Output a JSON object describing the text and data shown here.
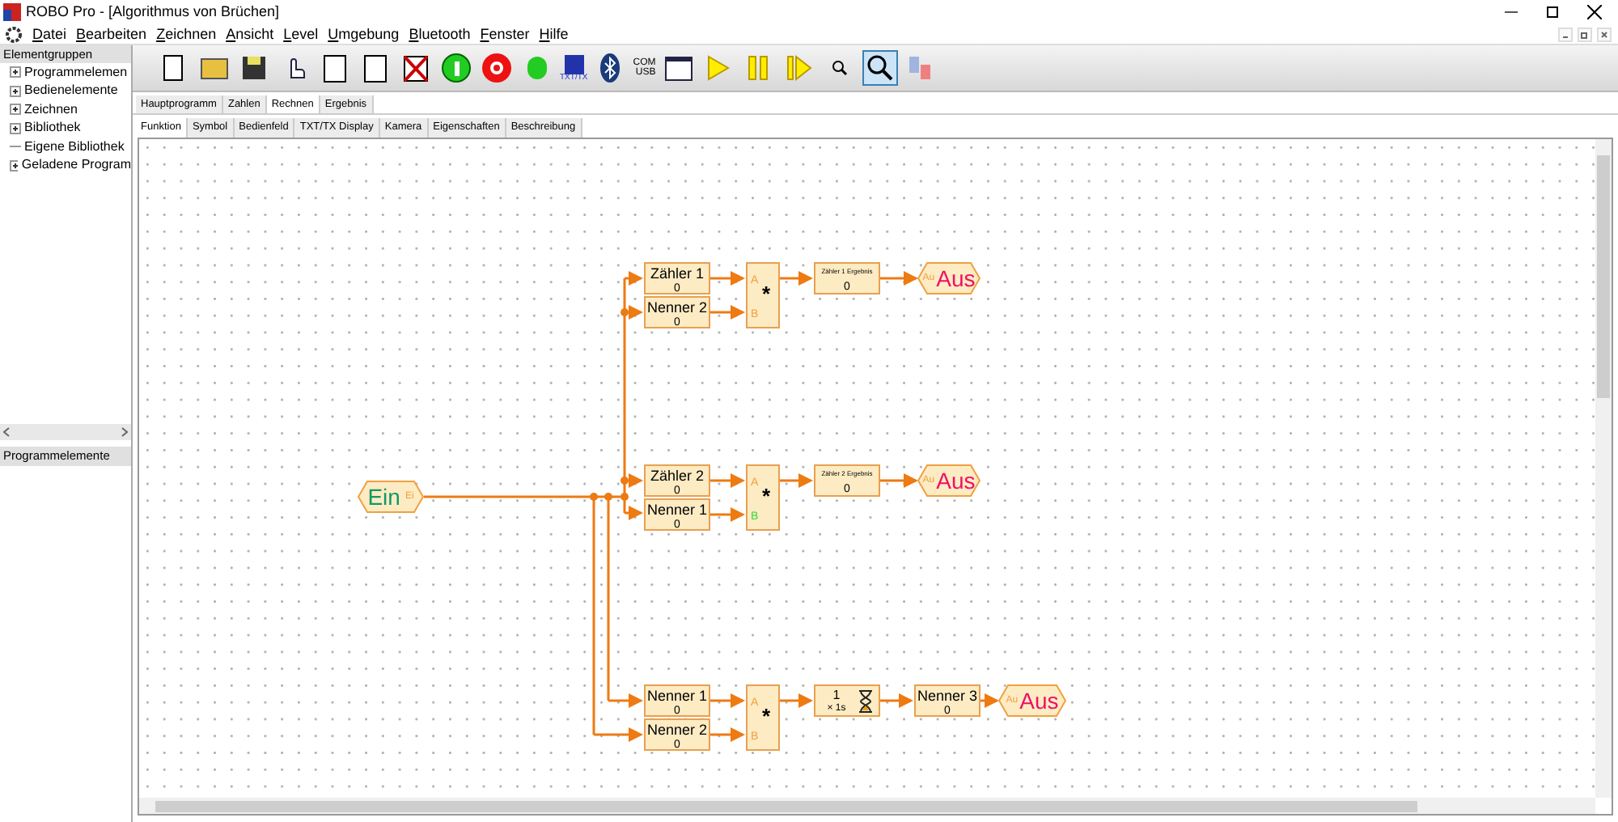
{
  "window": {
    "title": "ROBO Pro - [Algorithmus von Brüchen]"
  },
  "menu": [
    "Datei",
    "Bearbeiten",
    "Zeichnen",
    "Ansicht",
    "Level",
    "Umgebung",
    "Bluetooth",
    "Fenster",
    "Hilfe"
  ],
  "sidebar": {
    "header": "Elementgruppen",
    "items": [
      {
        "label": "Programmelemen",
        "expandable": true
      },
      {
        "label": "Bedienelemente",
        "expandable": true
      },
      {
        "label": "Zeichnen",
        "expandable": true
      },
      {
        "label": "Bibliothek",
        "expandable": true
      },
      {
        "label": "Eigene Bibliothek",
        "expandable": false
      },
      {
        "label": "Geladene Program",
        "expandable": true
      }
    ],
    "lower_header": "Programmelemente"
  },
  "toolbar": {
    "txt_label": "TXT/TX",
    "com_label": "COM",
    "usb_label": "USB"
  },
  "program_tabs": [
    {
      "label": "Hauptprogramm",
      "selected": false
    },
    {
      "label": "Zahlen",
      "selected": false
    },
    {
      "label": "Rechnen",
      "selected": true
    },
    {
      "label": "Ergebnis",
      "selected": false
    }
  ],
  "view_tabs": [
    {
      "label": "Funktion",
      "selected": true
    },
    {
      "label": "Symbol",
      "selected": false
    },
    {
      "label": "Bedienfeld",
      "selected": false
    },
    {
      "label": "TXT/TX Display",
      "selected": false
    },
    {
      "label": "Kamera",
      "selected": false
    },
    {
      "label": "Eigenschaften",
      "selected": false
    },
    {
      "label": "Beschreibung",
      "selected": false
    }
  ],
  "diagram": {
    "input": {
      "label": "Ein",
      "port": "Ei"
    },
    "rows": [
      {
        "inputs": [
          {
            "name": "Zähler 1",
            "value": "0"
          },
          {
            "name": "Nenner 2",
            "value": "0"
          }
        ],
        "operator": {
          "symbol": "*",
          "ports": [
            {
              "label": "A",
              "color": "#f0a040"
            },
            {
              "label": "B",
              "color": "#f0a040"
            }
          ]
        },
        "steps": [
          {
            "kind": "display",
            "name": "Zähler 1 Ergebnis",
            "value": "0"
          }
        ],
        "output": {
          "label": "Aus",
          "port": "Au"
        }
      },
      {
        "inputs": [
          {
            "name": "Zähler 2",
            "value": "0"
          },
          {
            "name": "Nenner 1",
            "value": "0"
          }
        ],
        "operator": {
          "symbol": "*",
          "ports": [
            {
              "label": "A",
              "color": "#f0a040"
            },
            {
              "label": "B",
              "color": "#33dd33"
            }
          ]
        },
        "steps": [
          {
            "kind": "display",
            "name": "Zähler 2 Ergebnis",
            "value": "0"
          }
        ],
        "output": {
          "label": "Aus",
          "port": "Au"
        }
      },
      {
        "inputs": [
          {
            "name": "Nenner 1",
            "value": "0"
          },
          {
            "name": "Nenner 2",
            "value": "0"
          }
        ],
        "operator": {
          "symbol": "*",
          "ports": [
            {
              "label": "A",
              "color": "#f0a040"
            },
            {
              "label": "B",
              "color": "#f0a040"
            }
          ]
        },
        "steps": [
          {
            "kind": "timer",
            "value": "1",
            "unit": "× 1s"
          },
          {
            "kind": "variable",
            "name": "Nenner 3",
            "value": "0"
          }
        ],
        "output": {
          "label": "Aus",
          "port": "Au"
        }
      }
    ]
  }
}
